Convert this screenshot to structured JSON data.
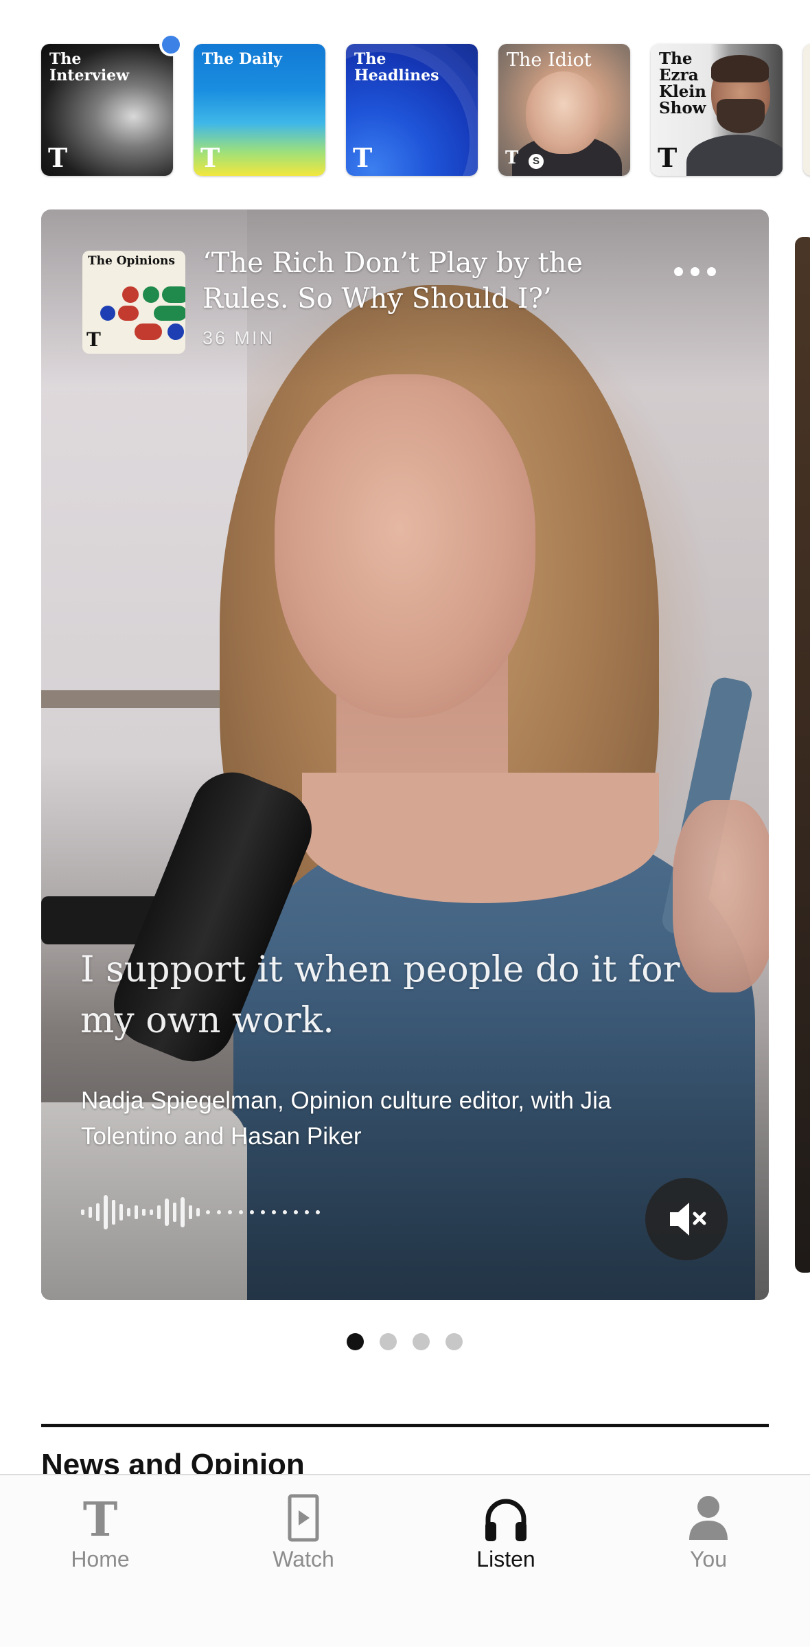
{
  "shows": [
    {
      "title": "The Interview",
      "logo": "T"
    },
    {
      "title": "The Daily",
      "logo": "T"
    },
    {
      "title": "The Headlines",
      "logo": "T"
    },
    {
      "title": "The Idiot",
      "logo": "T",
      "badge": "S"
    },
    {
      "title": "The Ezra Klein Show",
      "logo": "T"
    }
  ],
  "hero": {
    "show_art_title": "The Opinions",
    "show_art_logo": "T",
    "episode_title": "‘The Rich Don’t Play by the Rules. So Why Should I?’",
    "duration": "36 MIN",
    "quote": "I support it when people do it for my own work.",
    "speaker": "Nadja Spiegelman, Opinion culture editor, with Jia Tolentino and Hasan Piker",
    "mute_icon": "muted-speaker-icon",
    "more_icon": "more-options-icon",
    "page_count": 4,
    "active_page": 1
  },
  "section": {
    "title": "News and Opinion"
  },
  "tabbar": {
    "tabs": [
      {
        "label": "Home",
        "icon": "nyt-logo-icon"
      },
      {
        "label": "Watch",
        "icon": "play-icon"
      },
      {
        "label": "Listen",
        "icon": "headphones-icon"
      },
      {
        "label": "You",
        "icon": "person-icon"
      }
    ],
    "active": "Listen"
  },
  "colors": {
    "unread_dot": "#3c82e6",
    "text_primary": "#121212",
    "text_muted": "#8c8c8c"
  }
}
